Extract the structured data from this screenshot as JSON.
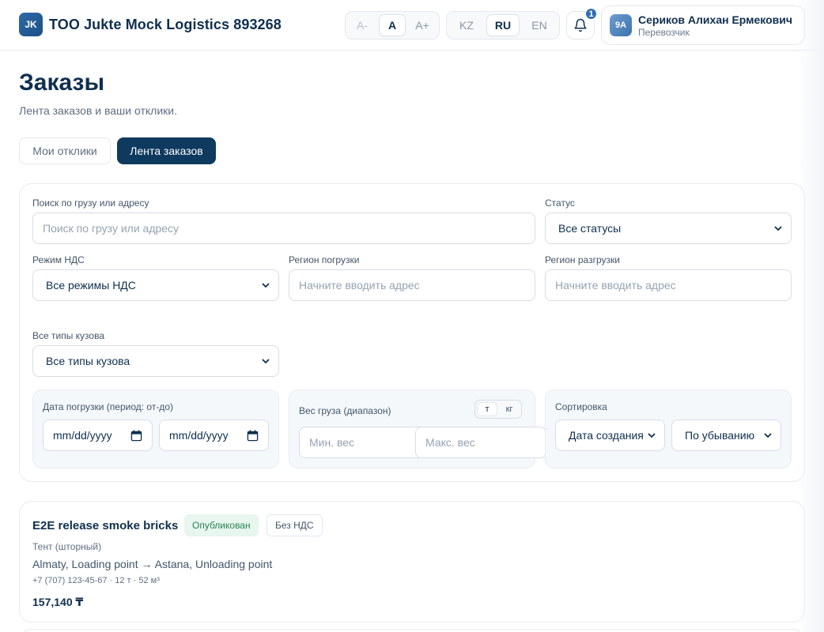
{
  "header": {
    "logo_initials": "JK",
    "company_name": "TOO Jukte Mock Logistics 893268",
    "font_size": {
      "decrease": "A-",
      "normal": "A",
      "increase": "A+"
    },
    "languages": [
      "KZ",
      "RU",
      "EN"
    ],
    "active_language": "RU",
    "notifications_count": "1",
    "user": {
      "initials": "9A",
      "name": "Сериков Алихан Ермекович",
      "role": "Перевозчик"
    }
  },
  "page": {
    "title": "Заказы",
    "subtitle": "Лента заказов и ваши отклики."
  },
  "tabs": {
    "mine": "Мои отклики",
    "feed": "Лента заказов",
    "active": "feed"
  },
  "filters": {
    "search_label": "Поиск по грузу или адресу",
    "search_placeholder": "Поиск по грузу или адресу",
    "status_label": "Статус",
    "status_value": "Все статусы",
    "vat_label": "Режим НДС",
    "vat_value": "Все режимы НДС",
    "loading_region_label": "Регион погрузки",
    "loading_region_placeholder": "Начните вводить адрес",
    "unloading_region_label": "Регион разгрузки",
    "unloading_region_placeholder": "Начните вводить адрес",
    "body_type_label": "Все типы кузова",
    "body_type_value": "Все типы кузова",
    "loading_date_label": "Дата погрузки (период: от-до)",
    "date_from": "mm/dd/yyyy",
    "date_to": "mm/dd/yyyy",
    "weight_label": "Вес груза (диапазон)",
    "weight_units": [
      "т",
      "кг"
    ],
    "weight_unit_active": "т",
    "weight_min_placeholder": "Мин. вес",
    "weight_max_placeholder": "Макс. вес",
    "sort_label": "Сортировка",
    "sort_field": "Дата создания",
    "sort_order": "По убыванию"
  },
  "orders": [
    {
      "title": "E2E release smoke bricks",
      "status": "Опубликован",
      "vat": "Без НДС",
      "body_type": "Тент (шторный)",
      "route": "Almaty, Loading point → Astana, Unloading point",
      "meta": "+7 (707) 123-45-67 · 12 т · 52 м³",
      "price": "157,140 ₸"
    }
  ],
  "colors": {
    "primary": "#0f3a5f",
    "brand": "#1d4f86",
    "status_published_bg": "#e7f6ee",
    "status_published_text": "#2a8356"
  }
}
